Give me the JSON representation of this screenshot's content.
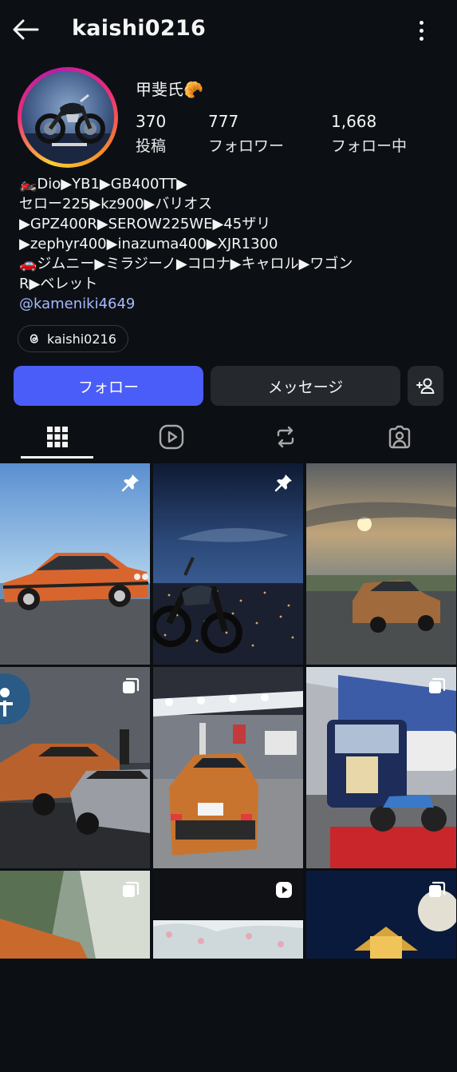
{
  "header": {
    "username": "kaishi0216",
    "back_icon": "arrow-left-icon",
    "more_icon": "more-vertical-icon"
  },
  "profile": {
    "display_name": "甲斐氏🥐",
    "stats": [
      {
        "value": "370",
        "label": "投稿"
      },
      {
        "value": "777",
        "label": "フォロワー"
      },
      {
        "value": "1,668",
        "label": "フォロー中"
      }
    ],
    "bio": "🏍️Dio▶YB1▶GB400TT▶\nセロー225▶kz900▶バリオス\n▶GPZ400R▶SEROW225WE▶45ザリ\n▶zephyr400▶inazuma400▶XJR1300\n🚗ジムニー▶ミラジーノ▶コロナ▶キャロル▶ワゴン\nR▶ベレット",
    "link": "@kameniki4649",
    "threads_label": "kaishi0216"
  },
  "actions": {
    "follow_label": "フォロー",
    "message_label": "メッセージ",
    "follow_color": "#4a5df9"
  },
  "tabs": [
    "grid-icon",
    "reels-icon",
    "reposts-icon",
    "tagged-icon"
  ],
  "grid": [
    {
      "overlay": "pin-icon"
    },
    {
      "overlay": "pin-icon"
    },
    {
      "overlay": ""
    },
    {
      "overlay": "carousel-icon"
    },
    {
      "overlay": ""
    },
    {
      "overlay": "carousel-icon"
    },
    {
      "overlay": "carousel-icon"
    },
    {
      "overlay": "reel-icon"
    },
    {
      "overlay": "carousel-icon"
    }
  ]
}
